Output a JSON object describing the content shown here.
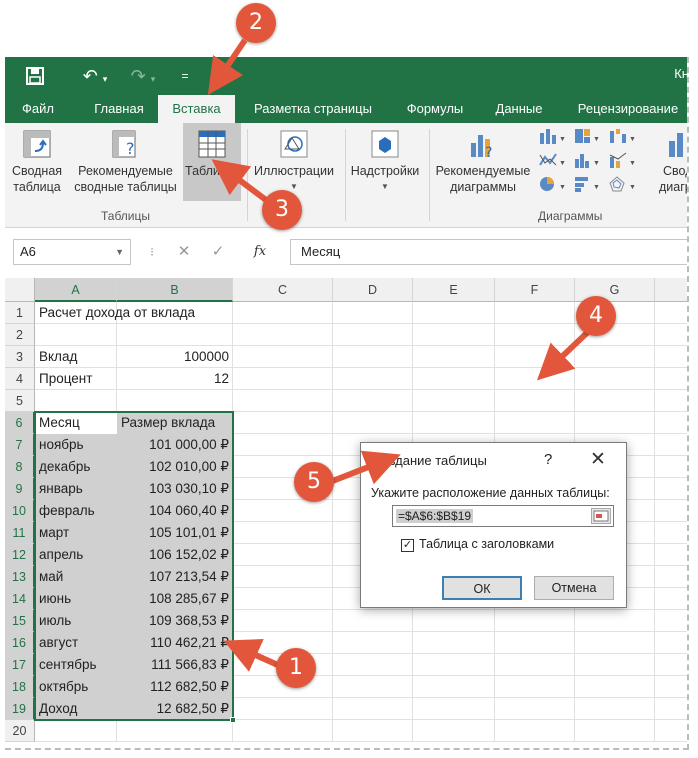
{
  "app": {
    "title_partial": "Кн"
  },
  "qat": {
    "save_icon": "save-icon",
    "undo_icon": "undo-icon",
    "redo_icon": "redo-icon",
    "customize_icon": "customize-icon"
  },
  "tabs": [
    {
      "label": "Файл"
    },
    {
      "label": "Главная"
    },
    {
      "label": "Вставка"
    },
    {
      "label": "Разметка страницы"
    },
    {
      "label": "Формулы"
    },
    {
      "label": "Данные"
    },
    {
      "label": "Рецензирование"
    }
  ],
  "ribbon": {
    "pivot": {
      "line1": "Сводная",
      "line2": "таблица"
    },
    "rec_pivot": {
      "line1": "Рекомендуемые",
      "line2": "сводные таблицы"
    },
    "table": {
      "label": "Табли"
    },
    "tables_group": "Таблицы",
    "illustrations": {
      "label": "Иллюстрации"
    },
    "addins": {
      "label": "Надстройки"
    },
    "rec_charts": {
      "line1": "Рекомендуемые",
      "line2": "диаграммы"
    },
    "charts_group": "Диаграммы",
    "pivot_chart": {
      "line1": "Своди",
      "line2": "диагра"
    }
  },
  "formula_bar": {
    "name_box": "A6",
    "cancel": "✕",
    "enter": "✓",
    "fx": "fx",
    "content": "Месяц"
  },
  "columns": [
    "A",
    "B",
    "C",
    "D",
    "E",
    "F",
    "G"
  ],
  "rows": [
    "1",
    "2",
    "3",
    "4",
    "5",
    "6",
    "7",
    "8",
    "9",
    "10",
    "11",
    "12",
    "13",
    "14",
    "15",
    "16",
    "17",
    "18",
    "19",
    "20"
  ],
  "sheet": {
    "title": "Расчет дохода от вклада",
    "deposit_label": "Вклад",
    "deposit_value": "100000",
    "percent_label": "Процент",
    "percent_value": "12",
    "header_month": "Месяц",
    "header_amount": "Размер вклада",
    "data": [
      {
        "month": "ноябрь",
        "amount": "101 000,00 ₽"
      },
      {
        "month": "декабрь",
        "amount": "102 010,00 ₽"
      },
      {
        "month": "январь",
        "amount": "103 030,10 ₽"
      },
      {
        "month": "февраль",
        "amount": "104 060,40 ₽"
      },
      {
        "month": "март",
        "amount": "105 101,01 ₽"
      },
      {
        "month": "апрель",
        "amount": "106 152,02 ₽"
      },
      {
        "month": "май",
        "amount": "107 213,54 ₽"
      },
      {
        "month": "июнь",
        "amount": "108 285,67 ₽"
      },
      {
        "month": "июль",
        "amount": "109 368,53 ₽"
      },
      {
        "month": "август",
        "amount": "110 462,21 ₽"
      },
      {
        "month": "сентябрь",
        "amount": "111 566,83 ₽"
      },
      {
        "month": "октябрь",
        "amount": "112 682,50 ₽"
      },
      {
        "month": "Доход",
        "amount": "12 682,50 ₽"
      }
    ]
  },
  "dialog": {
    "title": "Создание таблицы",
    "help": "?",
    "close": "✕",
    "prompt": "Укажите расположение данных таблицы:",
    "range": "=$A$6:$B$19",
    "has_headers": "Таблица с заголовками",
    "has_headers_checked": true,
    "ok": "ОК",
    "cancel": "Отмена"
  },
  "callouts": [
    "1",
    "2",
    "3",
    "4",
    "5"
  ],
  "colors": {
    "brand": "#217346",
    "callout": "#e2573b",
    "selection": "#d0d0d0"
  }
}
